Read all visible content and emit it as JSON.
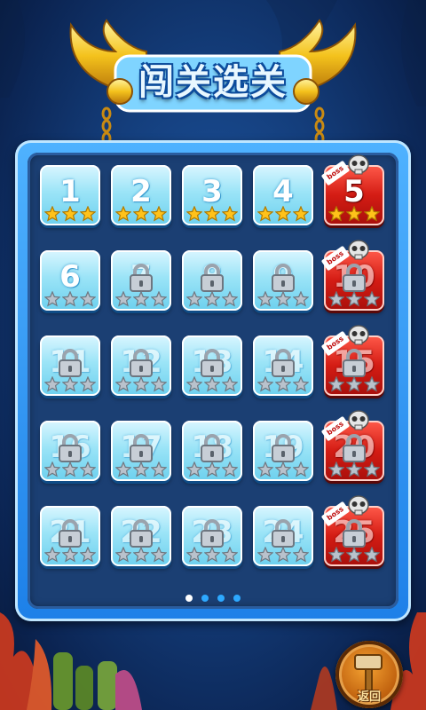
{
  "title": "闯关选关",
  "back_label": "返回",
  "boss_tag": "boss",
  "page_indicator": {
    "total": 4,
    "current": 1
  },
  "levels": [
    {
      "number": "1",
      "locked": false,
      "boss": false,
      "stars_earned": 3
    },
    {
      "number": "2",
      "locked": false,
      "boss": false,
      "stars_earned": 3
    },
    {
      "number": "3",
      "locked": false,
      "boss": false,
      "stars_earned": 3
    },
    {
      "number": "4",
      "locked": false,
      "boss": false,
      "stars_earned": 3
    },
    {
      "number": "5",
      "locked": false,
      "boss": true,
      "stars_earned": 3
    },
    {
      "number": "6",
      "locked": false,
      "boss": false,
      "stars_earned": 0
    },
    {
      "number": "7",
      "locked": true,
      "boss": false,
      "stars_earned": 0
    },
    {
      "number": "8",
      "locked": true,
      "boss": false,
      "stars_earned": 0
    },
    {
      "number": "9",
      "locked": true,
      "boss": false,
      "stars_earned": 0
    },
    {
      "number": "10",
      "locked": true,
      "boss": true,
      "stars_earned": 0
    },
    {
      "number": "11",
      "locked": true,
      "boss": false,
      "stars_earned": 0
    },
    {
      "number": "12",
      "locked": true,
      "boss": false,
      "stars_earned": 0
    },
    {
      "number": "13",
      "locked": true,
      "boss": false,
      "stars_earned": 0
    },
    {
      "number": "14",
      "locked": true,
      "boss": false,
      "stars_earned": 0
    },
    {
      "number": "15",
      "locked": true,
      "boss": true,
      "stars_earned": 0
    },
    {
      "number": "16",
      "locked": true,
      "boss": false,
      "stars_earned": 0
    },
    {
      "number": "17",
      "locked": true,
      "boss": false,
      "stars_earned": 0
    },
    {
      "number": "18",
      "locked": true,
      "boss": false,
      "stars_earned": 0
    },
    {
      "number": "19",
      "locked": true,
      "boss": false,
      "stars_earned": 0
    },
    {
      "number": "20",
      "locked": true,
      "boss": true,
      "stars_earned": 0
    },
    {
      "number": "21",
      "locked": true,
      "boss": false,
      "stars_earned": 0
    },
    {
      "number": "22",
      "locked": true,
      "boss": false,
      "stars_earned": 0
    },
    {
      "number": "23",
      "locked": true,
      "boss": false,
      "stars_earned": 0
    },
    {
      "number": "24",
      "locked": true,
      "boss": false,
      "stars_earned": 0
    },
    {
      "number": "25",
      "locked": true,
      "boss": true,
      "stars_earned": 0
    }
  ],
  "colors": {
    "star_gold": "#ffc21a",
    "star_gray": "#b9c2cc",
    "accent_blue": "#2da9ff",
    "boss_red": "#d41c14"
  }
}
